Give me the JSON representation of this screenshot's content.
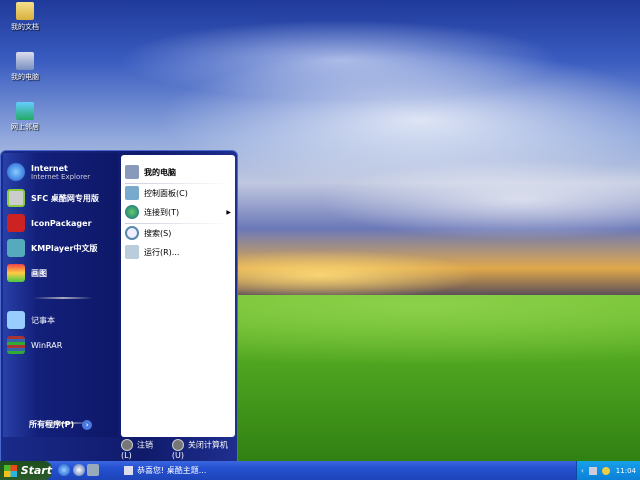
{
  "desktop": {
    "icons": [
      {
        "label": "我的文档"
      },
      {
        "label": "我的电脑"
      },
      {
        "label": "网上邻居"
      }
    ]
  },
  "start_menu": {
    "left_items": [
      {
        "label": "Internet",
        "sub": "Internet Explorer"
      },
      {
        "label": "SFC 桌酷网专用版"
      },
      {
        "label": "IconPackager"
      },
      {
        "label": "KMPlayer中文版"
      },
      {
        "label": "画图"
      },
      {
        "label": "记事本"
      },
      {
        "label": "WinRAR"
      }
    ],
    "all_programs": "所有程序(P)",
    "right_items": [
      {
        "label": "我的电脑"
      },
      {
        "label": "控制面板(C)"
      },
      {
        "label": "连接到(T)"
      },
      {
        "label": "搜索(S)"
      },
      {
        "label": "运行(R)..."
      }
    ],
    "logoff": "注销(L)",
    "shutdown": "关闭计算机(U)"
  },
  "taskbar": {
    "start": "Start",
    "task": "恭喜您! 桌酷主题...",
    "clock": "11:04"
  }
}
